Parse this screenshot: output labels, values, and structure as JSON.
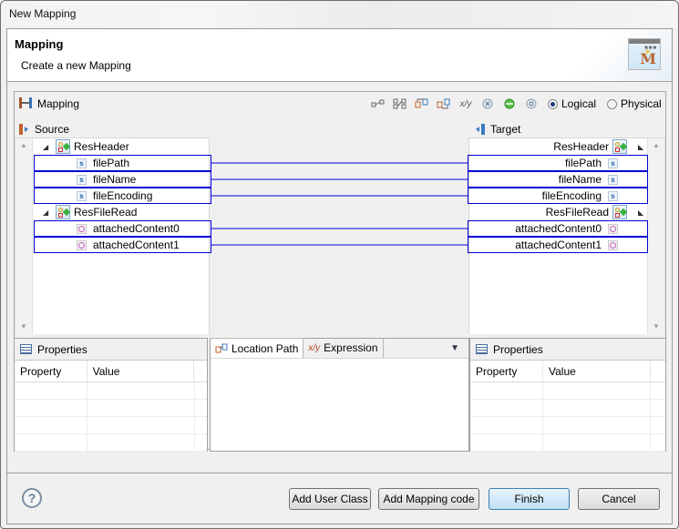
{
  "window": {
    "title": "New Mapping"
  },
  "header": {
    "title": "Mapping",
    "description": "Create a new Mapping",
    "icon": "mapping-wizard-icon"
  },
  "mapping_panel": {
    "title": "Mapping",
    "toolbar_icons": [
      "connect-icon",
      "connect-all-icon",
      "map-left-icon",
      "map-right-icon",
      "expression-icon",
      "clear-icon",
      "ok-icon",
      "settings-icon"
    ],
    "view_mode": {
      "options": [
        "Logical",
        "Physical"
      ],
      "selected": "Logical"
    },
    "source": {
      "label": "Source",
      "nodes": [
        {
          "label": "ResHeader",
          "type": "group",
          "expanded": true,
          "children": [
            {
              "label": "filePath",
              "type": "s",
              "mapped": true
            },
            {
              "label": "fileName",
              "type": "s",
              "mapped": true
            },
            {
              "label": "fileEncoding",
              "type": "s",
              "mapped": true
            }
          ]
        },
        {
          "label": "ResFileRead",
          "type": "group",
          "expanded": true,
          "children": [
            {
              "label": "attachedContent0",
              "type": "o",
              "mapped": true
            },
            {
              "label": "attachedContent1",
              "type": "o",
              "mapped": true
            }
          ]
        }
      ]
    },
    "target": {
      "label": "Target",
      "nodes": [
        {
          "label": "ResHeader",
          "type": "group",
          "expanded": true,
          "children": [
            {
              "label": "filePath",
              "type": "s",
              "mapped": true
            },
            {
              "label": "fileName",
              "type": "s",
              "mapped": true
            },
            {
              "label": "fileEncoding",
              "type": "s",
              "mapped": true
            }
          ]
        },
        {
          "label": "ResFileRead",
          "type": "group",
          "expanded": true,
          "children": [
            {
              "label": "attachedContent0",
              "type": "o",
              "mapped": true
            },
            {
              "label": "attachedContent1",
              "type": "o",
              "mapped": true
            }
          ]
        }
      ]
    },
    "connection_color": "#0000d8"
  },
  "properties_left": {
    "title": "Properties",
    "columns": [
      "Property",
      "Value"
    ],
    "rows": []
  },
  "middle_tabs": {
    "tabs": [
      {
        "label": "Location Path",
        "active": true
      },
      {
        "label": "Expression",
        "active": false
      }
    ]
  },
  "properties_right": {
    "title": "Properties",
    "columns": [
      "Property",
      "Value"
    ],
    "rows": []
  },
  "buttons": {
    "add_user_class": "Add User Class",
    "add_mapping_code": "Add Mapping code",
    "finish": "Finish",
    "cancel": "Cancel"
  }
}
